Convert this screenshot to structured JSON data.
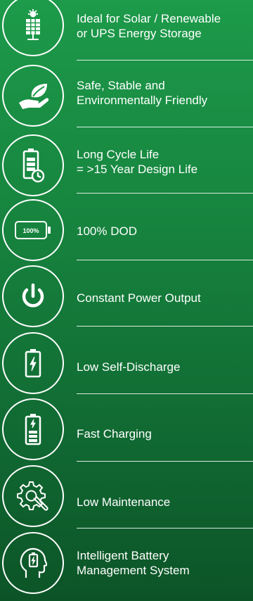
{
  "features": [
    {
      "icon": "solar-panel-icon",
      "text": "Ideal for Solar / Renewable\nor UPS Energy Storage"
    },
    {
      "icon": "leaf-in-hand-icon",
      "text": "Safe, Stable and\nEnvironmentally Friendly"
    },
    {
      "icon": "battery-clock-icon",
      "text": "Long Cycle Life\n= >15 Year Design Life"
    },
    {
      "icon": "battery-100-percent-icon",
      "text": "100% DOD",
      "icon_text": "100%"
    },
    {
      "icon": "power-icon",
      "text": "Constant Power Output"
    },
    {
      "icon": "battery-bolt-icon",
      "text": "Low Self-Discharge"
    },
    {
      "icon": "fast-charging-battery-icon",
      "text": "Fast Charging"
    },
    {
      "icon": "gear-wrench-icon",
      "text": "Low Maintenance"
    },
    {
      "icon": "head-battery-icon",
      "text": "Intelligent Battery\nManagement System"
    }
  ]
}
